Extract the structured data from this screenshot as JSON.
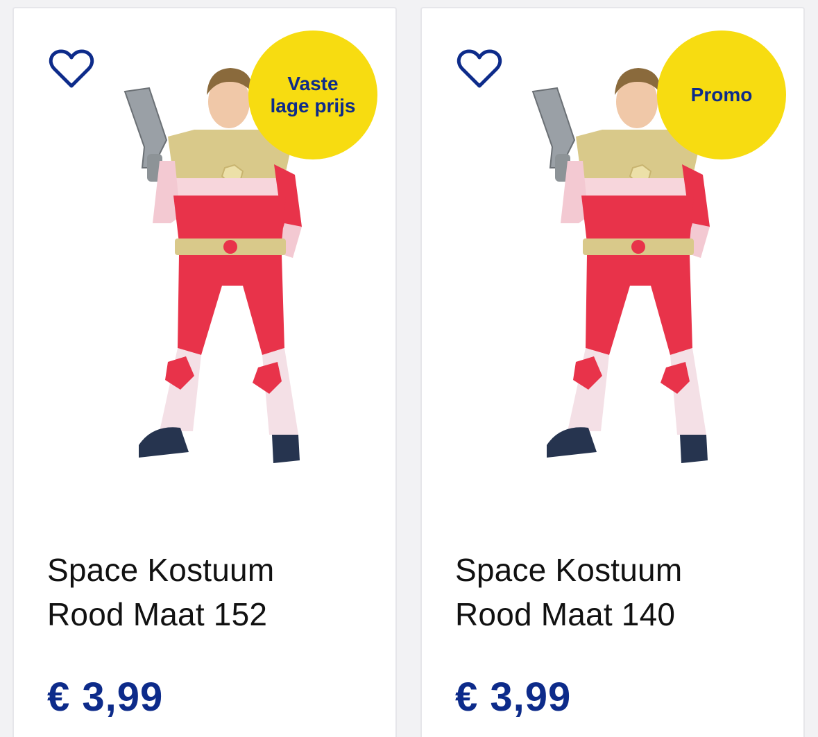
{
  "products": [
    {
      "badge": "Vaste lage prijs",
      "title_line1": "Space Kostuum",
      "title_line2": "Rood Maat 152",
      "price": "€ 3,99"
    },
    {
      "badge": "Promo",
      "title_line1": "Space Kostuum",
      "title_line2": "Rood Maat 140",
      "price": "€ 3,99"
    }
  ],
  "colors": {
    "brand_blue": "#0d2b8a",
    "badge_yellow": "#f7dc11",
    "card_bg": "#ffffff",
    "page_bg": "#f2f2f4"
  },
  "icons": {
    "favorite": "heart-outline-icon"
  }
}
